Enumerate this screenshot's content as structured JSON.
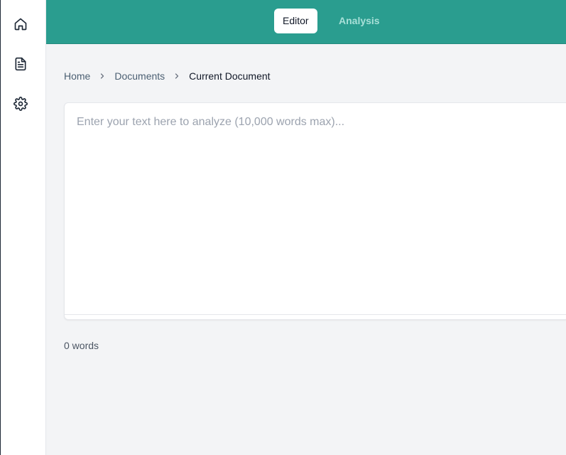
{
  "sidebar": {
    "items": [
      {
        "icon": "home-icon",
        "label": "Home"
      },
      {
        "icon": "document-icon",
        "label": "Documents"
      },
      {
        "icon": "gear-icon",
        "label": "Settings"
      }
    ]
  },
  "header": {
    "tabs": [
      {
        "label": "Editor",
        "active": true
      },
      {
        "label": "Analysis",
        "active": false
      }
    ],
    "accent_color": "#2a9d8f"
  },
  "breadcrumb": {
    "items": [
      "Home",
      "Documents",
      "Current Document"
    ]
  },
  "editor": {
    "value": "",
    "placeholder": "Enter your text here to analyze (10,000 words max)..."
  },
  "status": {
    "word_count": "0 words"
  }
}
